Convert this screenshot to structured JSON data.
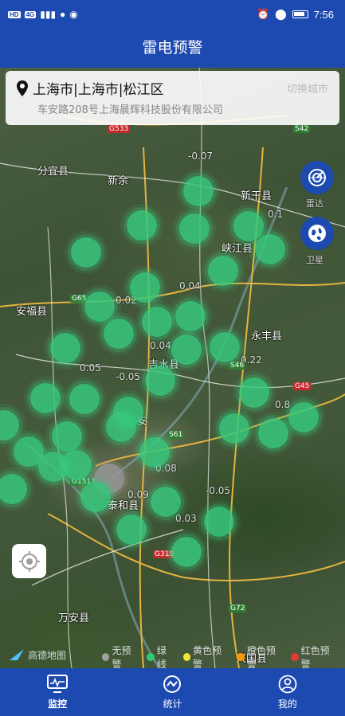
{
  "status_bar": {
    "left_badges": [
      "HD",
      "4G"
    ],
    "time": "7:56"
  },
  "header": {
    "title": "雷电预警"
  },
  "location": {
    "title": "上海市|上海市|松江区",
    "address": "车安路208号上海晨辉科技股份有限公司",
    "switch_label": "切换城市"
  },
  "map": {
    "places": [
      "分宜县",
      "新余",
      "新干县",
      "峡江县",
      "安福县",
      "永丰县",
      "吉水县",
      "吉安",
      "泰和县",
      "万安县",
      "兴国县"
    ],
    "values": [
      "-0.07",
      "0.1",
      "0.02",
      "0.04",
      "0.05",
      "-0.05",
      "0.22",
      "0.8",
      "0.08",
      "0.09",
      "0.03",
      "-0.05",
      "0.04"
    ],
    "roads": [
      "G533",
      "S42",
      "G65",
      "S46",
      "S61",
      "G1517",
      "G319",
      "G72",
      "G45"
    ],
    "side_buttons": [
      {
        "icon": "radar-icon",
        "label": "雷达"
      },
      {
        "icon": "globe-icon",
        "label": "卫星"
      }
    ]
  },
  "legend": {
    "logo": "高德地图",
    "items": [
      {
        "label": "无预警",
        "color": "#9e9e9e"
      },
      {
        "label": "绿线",
        "color": "#2ecc71"
      },
      {
        "label": "黄色预警",
        "color": "#f1e531"
      },
      {
        "label": "橙色预警",
        "color": "#ff9800"
      },
      {
        "label": "红色预警",
        "color": "#e53935"
      }
    ]
  },
  "nav": {
    "items": [
      {
        "label": "监控",
        "icon": "monitor-icon",
        "active": true
      },
      {
        "label": "统计",
        "icon": "chart-icon",
        "active": false
      },
      {
        "label": "我的",
        "icon": "user-icon",
        "active": false
      }
    ]
  }
}
